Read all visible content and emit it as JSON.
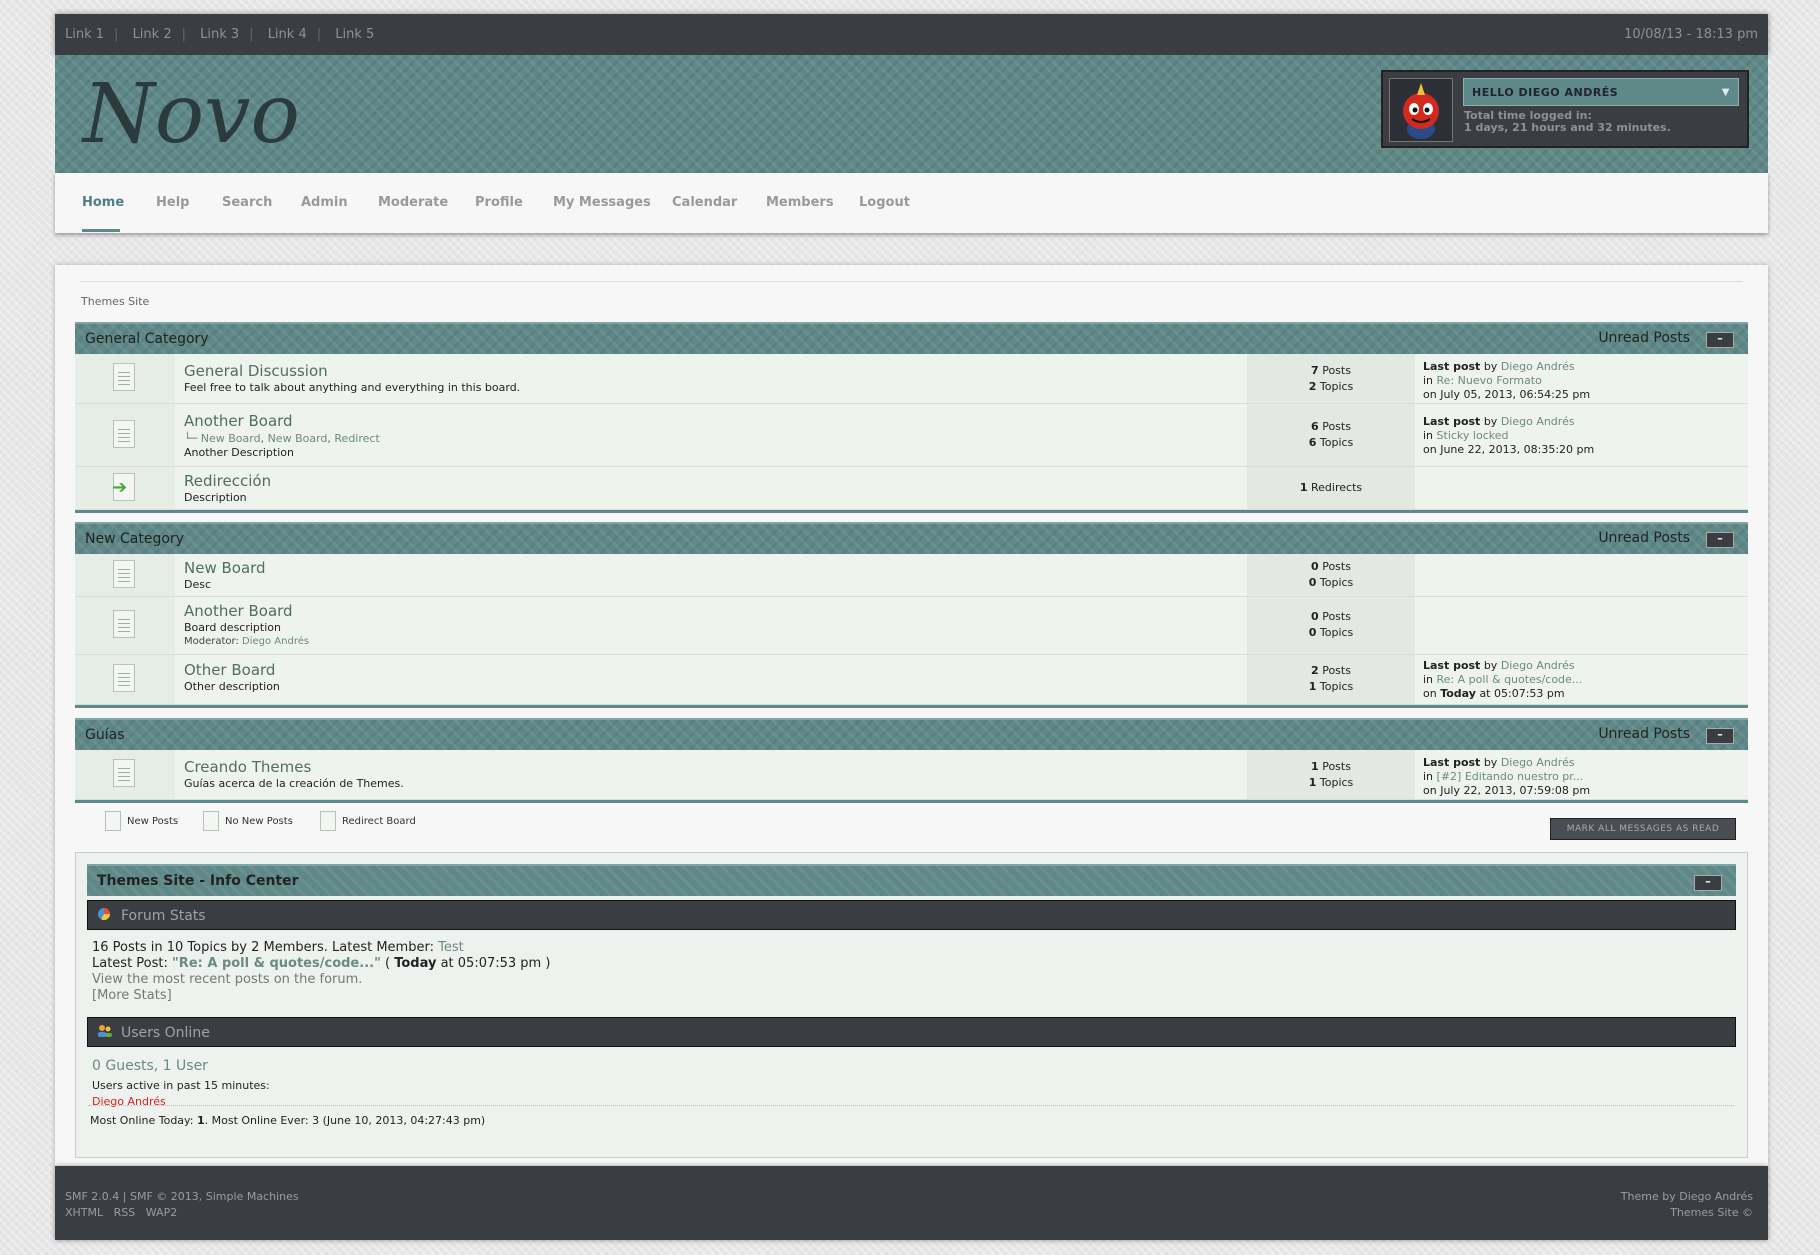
{
  "topbar": {
    "links": [
      "Link 1",
      "Link 2",
      "Link 3",
      "Link 4",
      "Link 5"
    ],
    "datetime": "10/08/13 - 18:13 pm"
  },
  "header": {
    "logo": "Novo",
    "user": {
      "greeting": "HELLO DIEGO ANDRÉS",
      "time_label": "Total time logged in:",
      "time_value": "1 days, 21 hours and 32 minutes."
    }
  },
  "nav": {
    "items": [
      "Home",
      "Help",
      "Search",
      "Admin",
      "Moderate",
      "Profile",
      "My Messages",
      "Calendar",
      "Members",
      "Logout"
    ]
  },
  "breadcrumb": "Themes Site",
  "unread_label": "Unread Posts",
  "toggle_label": "–",
  "categories": [
    {
      "title": "General Category",
      "boards": [
        {
          "name": "General Discussion",
          "desc": "Feel free to talk about anything and everything in this board.",
          "posts": "7",
          "topics": "2",
          "last_by": "Diego Andrés",
          "last_in": "Re: Nuevo Formato",
          "last_on": "July 05, 2013, 06:54:25 pm"
        },
        {
          "name": "Another Board",
          "children_prefix": "└─",
          "children": [
            "New Board",
            "New Board",
            "Redirect"
          ],
          "desc": "Another Description",
          "posts": "6",
          "topics": "6",
          "last_by": "Diego Andrés",
          "last_in": "Sticky locked",
          "last_on": "June 22, 2013, 08:35:20 pm"
        },
        {
          "name": "Redirección",
          "desc": "Description",
          "redirects": "1"
        }
      ]
    },
    {
      "title": "New Category",
      "boards": [
        {
          "name": "New Board",
          "desc": "Desc",
          "posts": "0",
          "topics": "0"
        },
        {
          "name": "Another Board",
          "desc": "Board description",
          "moderator_label": "Moderator:",
          "moderator": "Diego Andrés",
          "posts": "0",
          "topics": "0"
        },
        {
          "name": "Other Board",
          "desc": "Other description",
          "posts": "2",
          "topics": "1",
          "last_by": "Diego Andrés",
          "last_in": "Re: A poll & quotes/code...",
          "last_on_bold": "Today",
          "last_on": "at 05:07:53 pm"
        }
      ]
    },
    {
      "title": "Guías",
      "boards": [
        {
          "name": "Creando Themes",
          "desc": "Guías acerca de la creación de Themes.",
          "posts": "1",
          "topics": "1",
          "last_by": "Diego Andrés",
          "last_in": "[#2] Editando nuestro pr...",
          "last_on": "July 22, 2013, 07:59:08 pm"
        }
      ]
    }
  ],
  "labels": {
    "posts": "Posts",
    "topics": "Topics",
    "redirects": "Redirects",
    "last_post": "Last post",
    "by": "by",
    "in": "in",
    "on": "on"
  },
  "legend": {
    "new_posts": "New Posts",
    "no_new_posts": "No New Posts",
    "redirect_board": "Redirect Board"
  },
  "mark_read": "MARK ALL MESSAGES AS READ",
  "info_center": {
    "title": "Themes Site - Info Center",
    "forum_stats": {
      "title": "Forum Stats",
      "line1": "16 Posts in 10 Topics by 2 Members. Latest Member:",
      "latest_member": "Test",
      "latest_post_label": "Latest Post:",
      "latest_post": "\"Re: A poll & quotes/code...\"",
      "latest_post_open": "(",
      "latest_post_when_bold": "Today",
      "latest_post_when": "at 05:07:53 pm )",
      "recent_link": "View the most recent posts on the forum.",
      "more_stats": "[More Stats]"
    },
    "users_online": {
      "title": "Users Online",
      "count": "0 Guests, 1 User",
      "active_label": "Users active in past 15 minutes:",
      "active_user": "Diego Andrés",
      "most_online_today_label": "Most Online Today:",
      "most_online_today": "1",
      "most_online_ever": ". Most Online Ever: 3 (June 10, 2013, 04:27:43 pm)"
    }
  },
  "footer": {
    "left1": "SMF 2.0.4 | SMF © 2013, Simple Machines",
    "left2": [
      "XHTML",
      "RSS",
      "WAP2"
    ],
    "right1": "Theme by Diego Andrés",
    "right2": "Themes Site ©"
  },
  "colors": {
    "accent": "#5f8888",
    "dark": "#3a3d42",
    "online_user": "#e02020"
  }
}
